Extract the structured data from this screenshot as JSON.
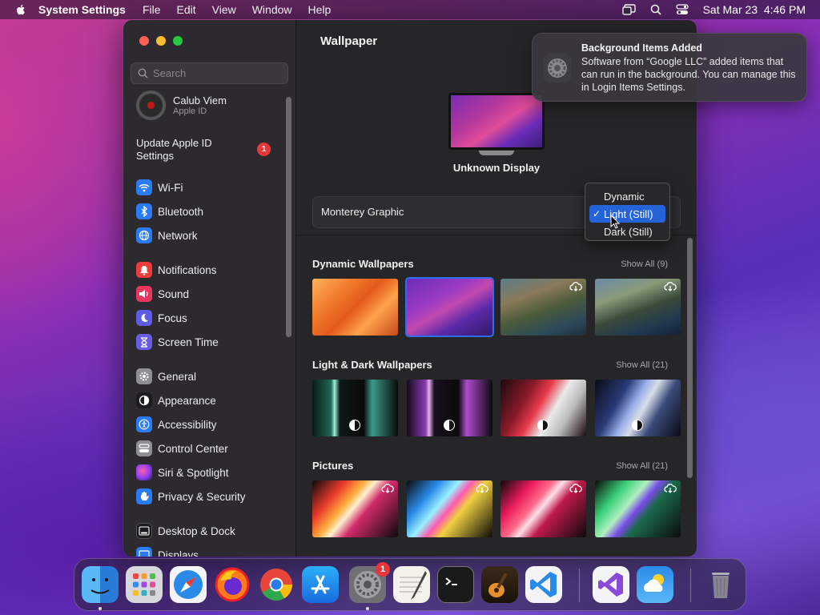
{
  "menubar": {
    "app_name": "System Settings",
    "menus": [
      "File",
      "Edit",
      "View",
      "Window",
      "Help"
    ],
    "datetime": "Sat Mar 23  4:46 PM"
  },
  "sidebar": {
    "search_placeholder": "Search",
    "account": {
      "name": "Calub Viem",
      "subtitle": "Apple ID"
    },
    "update": {
      "label": "Update Apple ID Settings",
      "badge": "1"
    },
    "items": [
      {
        "label": "Wi-Fi",
        "icon": "wifi-icon",
        "color": "#2a7cf6"
      },
      {
        "label": "Bluetooth",
        "icon": "bluetooth-icon",
        "color": "#2a7cf6"
      },
      {
        "label": "Network",
        "icon": "globe-icon",
        "color": "#2a7cf6"
      },
      {
        "label": "Notifications",
        "icon": "bell-icon",
        "color": "#ec3c3c"
      },
      {
        "label": "Sound",
        "icon": "speaker-icon",
        "color": "#e8375e"
      },
      {
        "label": "Focus",
        "icon": "moon-icon",
        "color": "#5e5ce6"
      },
      {
        "label": "Screen Time",
        "icon": "hourglass-icon",
        "color": "#6a5ee6"
      },
      {
        "label": "General",
        "icon": "gear-icon",
        "color": "#8e8e93"
      },
      {
        "label": "Appearance",
        "icon": "appearance-icon",
        "color": "#1c1c1e"
      },
      {
        "label": "Accessibility",
        "icon": "accessibility-icon",
        "color": "#2a7cf6"
      },
      {
        "label": "Control Center",
        "icon": "control-center-icon",
        "color": "#8e8e93"
      },
      {
        "label": "Siri & Spotlight",
        "icon": "siri-icon",
        "color": "#c0399f"
      },
      {
        "label": "Privacy & Security",
        "icon": "hand-icon",
        "color": "#2a7cf6"
      },
      {
        "label": "Desktop & Dock",
        "icon": "dock-icon",
        "color": "#1c1c1e"
      },
      {
        "label": "Displays",
        "icon": "display-icon",
        "color": "#2a7cf6"
      }
    ]
  },
  "content": {
    "title": "Wallpaper",
    "display_name": "Unknown Display",
    "current_wallpaper": "Monterey Graphic",
    "dropdown_options": [
      {
        "label": "Dynamic",
        "selected": false
      },
      {
        "label": "Light (Still)",
        "selected": true
      },
      {
        "label": "Dark (Still)",
        "selected": false
      }
    ],
    "sections": [
      {
        "title": "Dynamic Wallpapers",
        "show_all": "Show All (9)"
      },
      {
        "title": "Light & Dark Wallpapers",
        "show_all": "Show All (21)"
      },
      {
        "title": "Pictures",
        "show_all": "Show All (21)"
      }
    ]
  },
  "notification": {
    "title": "Background Items Added",
    "body": "Software from “Google LLC” added items that can run in the background. You can manage this in Login Items Settings."
  },
  "dock": {
    "apps": [
      {
        "name": "finder",
        "running": true
      },
      {
        "name": "launchpad",
        "running": false
      },
      {
        "name": "safari",
        "running": false
      },
      {
        "name": "firefox",
        "running": false
      },
      {
        "name": "chrome",
        "running": false
      },
      {
        "name": "app-store",
        "running": false
      },
      {
        "name": "system-settings",
        "running": true,
        "badge": "1"
      },
      {
        "name": "textedit",
        "running": false
      },
      {
        "name": "terminal",
        "running": false
      },
      {
        "name": "garageband",
        "running": false
      },
      {
        "name": "vscode",
        "running": false
      },
      {
        "name": "visual-studio",
        "running": false
      },
      {
        "name": "weather",
        "running": false
      },
      {
        "name": "trash",
        "running": false
      }
    ]
  }
}
